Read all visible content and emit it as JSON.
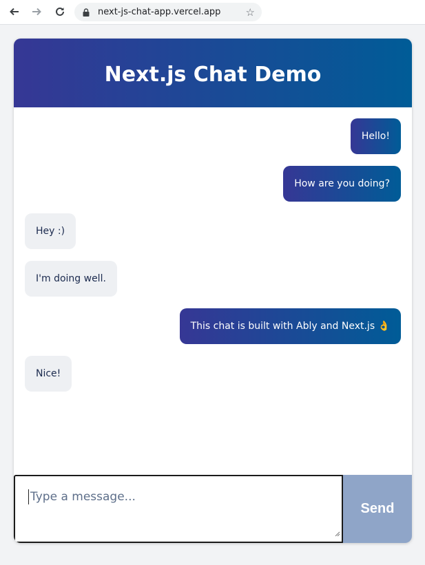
{
  "browser": {
    "url": "next-js-chat-app.vercel.app",
    "icons": [
      "back-arrow-icon",
      "forward-arrow-icon",
      "reload-icon",
      "lock-icon",
      "star-icon"
    ]
  },
  "chat": {
    "title": "Next.js Chat Demo",
    "accent_gradient": [
      "#363795",
      "#005c97"
    ],
    "messages": [
      {
        "text": "Hello!",
        "from": "me"
      },
      {
        "text": "How are you doing?",
        "from": "me"
      },
      {
        "text": "Hey :)",
        "from": "other"
      },
      {
        "text": "I'm doing well.",
        "from": "other"
      },
      {
        "text": "This chat is built with Ably and Next.js 👌",
        "from": "me"
      },
      {
        "text": "Nice!",
        "from": "other"
      }
    ],
    "composer": {
      "placeholder": "Type a message...",
      "send_label": "Send"
    }
  }
}
